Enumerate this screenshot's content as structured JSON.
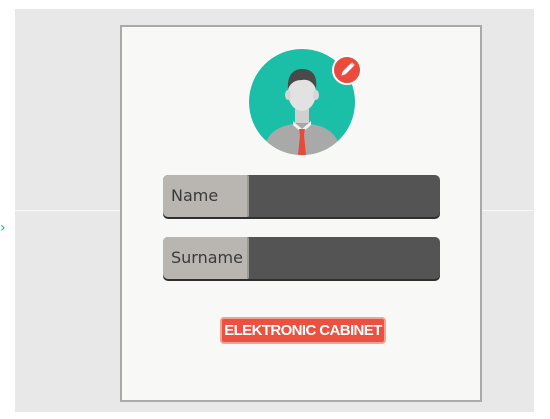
{
  "form": {
    "avatar": {
      "icon": "user-avatar-icon",
      "background_color": "#1bbfa8"
    },
    "edit_avatar": {
      "icon": "pencil-icon",
      "color": "#ea4b3d"
    },
    "name_field": {
      "label": "Name",
      "value": ""
    },
    "surname_field": {
      "label": "Surname",
      "value": ""
    },
    "submit_button": {
      "label": "ELEKTRONIC CABINET",
      "color": "#ea5140"
    }
  },
  "colors": {
    "backdrop": "#e8e8e8",
    "card": "#f8f8f6",
    "field_body": "#545454",
    "field_label": "#b9b6b2"
  }
}
